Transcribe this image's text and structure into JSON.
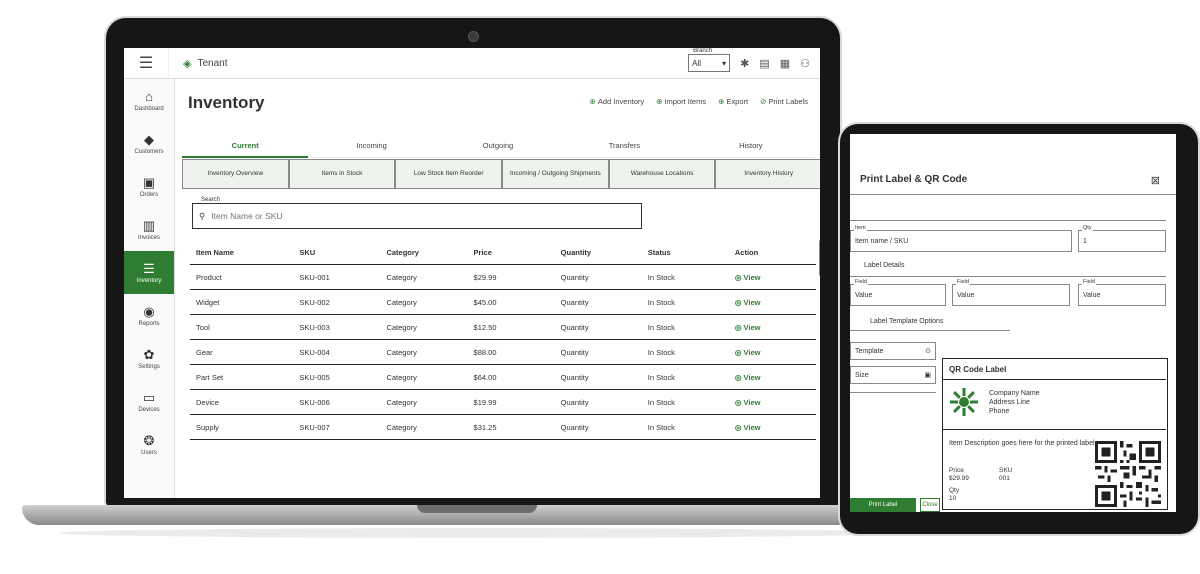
{
  "topbar": {
    "tenant": "Tenant",
    "branch_label": "Branch",
    "branch_value": "All"
  },
  "sidebar": {
    "items": [
      {
        "label": "Dashboard",
        "icon": "home-icon"
      },
      {
        "label": "Customers",
        "icon": "customers-icon"
      },
      {
        "label": "Orders",
        "icon": "orders-icon"
      },
      {
        "label": "Invoices",
        "icon": "invoices-icon"
      },
      {
        "label": "Inventory",
        "icon": "inventory-icon",
        "active": true
      },
      {
        "label": "Reports",
        "icon": "reports-icon"
      },
      {
        "label": "Settings",
        "icon": "settings-icon"
      },
      {
        "label": "Devices",
        "icon": "devices-icon"
      },
      {
        "label": "Users",
        "icon": "users-icon"
      }
    ]
  },
  "main": {
    "title": "Inventory",
    "actions": [
      "Add Inventory",
      "Import Items",
      "Export",
      "Print Labels"
    ],
    "tabs": [
      "Current",
      "Incoming",
      "Outgoing",
      "Transfers",
      "History"
    ],
    "cards": [
      "Inventory Overview",
      "Items in Stock",
      "Low Stock Item Reorder",
      "Incoming / Outgoing Shipments",
      "Warehouse Locations",
      "Inventory History"
    ],
    "search": {
      "label": "Search",
      "placeholder": "Item Name or SKU"
    },
    "table": {
      "headers": [
        "Item Name",
        "SKU",
        "Category",
        "Price",
        "Quantity",
        "Status",
        "Action"
      ],
      "rows": [
        [
          "Product",
          "SKU-001",
          "Category",
          "$29.99",
          "Quantity",
          "In Stock",
          "View"
        ],
        [
          "Widget",
          "SKU-002",
          "Category",
          "$45.00",
          "Quantity",
          "In Stock",
          "View"
        ],
        [
          "Tool",
          "SKU-003",
          "Category",
          "$12.50",
          "Quantity",
          "In Stock",
          "View"
        ],
        [
          "Gear",
          "SKU-004",
          "Category",
          "$88.00",
          "Quantity",
          "In Stock",
          "View"
        ],
        [
          "Part Set",
          "SKU-005",
          "Category",
          "$64.00",
          "Quantity",
          "In Stock",
          "View"
        ],
        [
          "Device",
          "SKU-006",
          "Category",
          "$19.99",
          "Quantity",
          "In Stock",
          "View"
        ],
        [
          "Supply",
          "SKU-007",
          "Category",
          "$31.25",
          "Quantity",
          "In Stock",
          "View"
        ]
      ]
    }
  },
  "tablet": {
    "modal_title": "Print Label & QR Code",
    "fields": {
      "item_label": "Item",
      "item_value": "Item name / SKU",
      "qty_label": "Qty",
      "qty_value": "1",
      "section_1": "Label Details",
      "f1_label": "Field",
      "f1_value": "Value",
      "f2_label": "Field",
      "f2_value": "Value",
      "f3_label": "Field",
      "f3_value": "Value",
      "section_2": "Label Template Options",
      "select_value": "Template",
      "size_value": "Size"
    },
    "preview": {
      "title": "QR Code Label",
      "company_line1": "Company Name",
      "company_line2": "Address Line",
      "company_line3": "Phone",
      "desc": "Item Description goes here for the printed label",
      "k1": "Price",
      "v1": "$29.99",
      "k2": "SKU",
      "v2": "001",
      "k3": "Qty",
      "v3": "10"
    },
    "print_button": "Print Label",
    "cancel_button": "Close"
  },
  "colors": {
    "accent": "#2e7d32",
    "frame": "#161616"
  }
}
